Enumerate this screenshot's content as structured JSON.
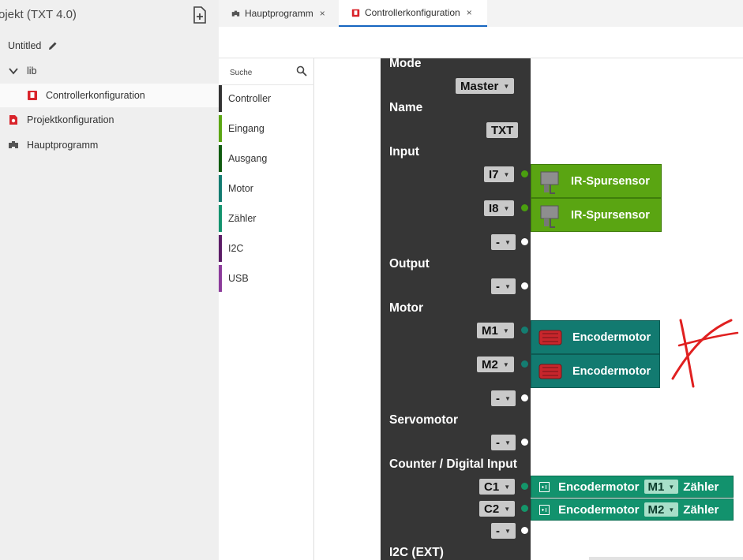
{
  "sidebar": {
    "project_title": "ojekt (TXT 4.0)",
    "items": [
      {
        "label": "Untitled"
      },
      {
        "label": "lib"
      },
      {
        "label": "Controllerkonfiguration"
      },
      {
        "label": "Projektkonfiguration"
      },
      {
        "label": "Hauptprogramm"
      }
    ]
  },
  "tabs": [
    {
      "label": "Hauptprogramm",
      "close": "×"
    },
    {
      "label": "Controllerkonfiguration",
      "close": "×"
    }
  ],
  "palette": {
    "search_placeholder": "Suche",
    "categories": [
      {
        "label": "Controller",
        "color": "#333333"
      },
      {
        "label": "Eingang",
        "color": "#5aa512"
      },
      {
        "label": "Ausgang",
        "color": "#0e5a0e"
      },
      {
        "label": "Motor",
        "color": "#127a70"
      },
      {
        "label": "Zähler",
        "color": "#12926d"
      },
      {
        "label": "I2C",
        "color": "#5b1b66"
      },
      {
        "label": "USB",
        "color": "#8b3a9a"
      }
    ]
  },
  "controller_block": {
    "sections": {
      "mode": "Mode",
      "name": "Name",
      "input": "Input",
      "output": "Output",
      "motor": "Motor",
      "servomotor": "Servomotor",
      "counter": "Counter / Digital Input",
      "i2c": "I2C (EXT)"
    },
    "mode_value": "Master",
    "name_value": "TXT",
    "inputs": [
      "I7",
      "I8",
      "-"
    ],
    "outputs": [
      "-"
    ],
    "motors": [
      "M1",
      "M2",
      "-"
    ],
    "servos": [
      "-"
    ],
    "counters": [
      "C1",
      "C2",
      "-"
    ]
  },
  "attached_blocks": {
    "sensors": [
      {
        "label": "IR-Spursensor"
      },
      {
        "label": "IR-Spursensor"
      }
    ],
    "motors": [
      {
        "label": "Encodermotor"
      },
      {
        "label": "Encodermotor"
      }
    ],
    "counters": [
      {
        "label": "Encodermotor",
        "motor": "M1",
        "suffix": "Zähler"
      },
      {
        "label": "Encodermotor",
        "motor": "M2",
        "suffix": "Zähler"
      }
    ]
  },
  "colors": {
    "accent": "#1565c0",
    "input_block": "#5aa512",
    "motor_block": "#127a70",
    "counter_block": "#12926d",
    "controller_block": "#363636",
    "annotation": "#e02020"
  }
}
